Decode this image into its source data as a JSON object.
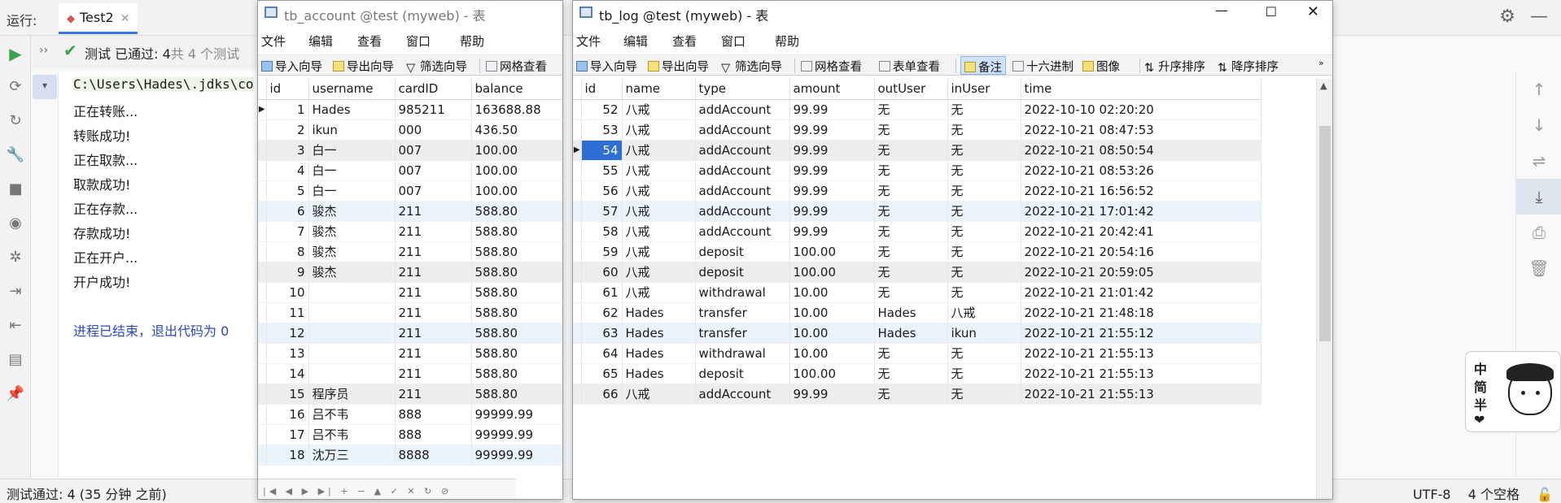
{
  "ide": {
    "run_label": "运行:",
    "tab_name": "Test2",
    "test_summary": "测试 已通过: 4",
    "test_summary_total": "共 4 个测试",
    "console_lines": [
      "正在转账...",
      "转账成功!",
      "正在取款...",
      "取款成功!",
      "正在存款...",
      "存款成功!",
      "正在开户...",
      "开户成功!"
    ],
    "console_path": "C:\\Users\\Hades\\.jdks\\co",
    "console_exit": "进程已结束，退出代码为 0",
    "status_left": "测试通过: 4 (35 分钟 之前)",
    "status_encoding": "UTF-8",
    "status_indent": "4 个空格",
    "ime_keys": [
      "中",
      "简",
      "半"
    ]
  },
  "account_window": {
    "title": "tb_account @test (myweb) - 表",
    "menu": [
      "文件",
      "编辑",
      "查看",
      "窗口",
      "帮助"
    ],
    "toolbar": [
      "导入向导",
      "导出向导",
      "筛选向导",
      "网格查看"
    ],
    "columns": [
      "id",
      "username",
      "cardID",
      "balance"
    ],
    "rows": [
      [
        "1",
        "Hades",
        "985211",
        "163688.88"
      ],
      [
        "2",
        "ikun",
        "000",
        "436.50"
      ],
      [
        "3",
        "白一",
        "007",
        "100.00"
      ],
      [
        "4",
        "白一",
        "007",
        "100.00"
      ],
      [
        "5",
        "白一",
        "007",
        "100.00"
      ],
      [
        "6",
        "骏杰",
        "211",
        "588.80"
      ],
      [
        "7",
        "骏杰",
        "211",
        "588.80"
      ],
      [
        "8",
        "骏杰",
        "211",
        "588.80"
      ],
      [
        "9",
        "骏杰",
        "211",
        "588.80"
      ],
      [
        "10",
        "",
        "211",
        "588.80"
      ],
      [
        "11",
        "",
        "211",
        "588.80"
      ],
      [
        "12",
        "",
        "211",
        "588.80"
      ],
      [
        "13",
        "",
        "211",
        "588.80"
      ],
      [
        "14",
        "",
        "211",
        "588.80"
      ],
      [
        "15",
        "程序员",
        "211",
        "588.80"
      ],
      [
        "16",
        "吕不韦",
        "888",
        "99999.99"
      ],
      [
        "17",
        "吕不韦",
        "888",
        "99999.99"
      ],
      [
        "18",
        "沈万三",
        "8888",
        "99999.99"
      ]
    ]
  },
  "log_window": {
    "title": "tb_log @test (myweb) - 表",
    "menu": [
      "文件",
      "编辑",
      "查看",
      "窗口",
      "帮助"
    ],
    "toolbar": [
      "导入向导",
      "导出向导",
      "筛选向导",
      "网格查看",
      "表单查看",
      "备注",
      "十六进制",
      "图像",
      "升序排序",
      "降序排序"
    ],
    "columns": [
      "id",
      "name",
      "type",
      "amount",
      "outUser",
      "inUser",
      "time"
    ],
    "selected_id": "54",
    "rows": [
      [
        "52",
        "八戒",
        "addAccount",
        "99.99",
        "无",
        "无",
        "2022-10-10 02:20:20"
      ],
      [
        "53",
        "八戒",
        "addAccount",
        "99.99",
        "无",
        "无",
        "2022-10-21 08:47:53"
      ],
      [
        "54",
        "八戒",
        "addAccount",
        "99.99",
        "无",
        "无",
        "2022-10-21 08:50:54"
      ],
      [
        "55",
        "八戒",
        "addAccount",
        "99.99",
        "无",
        "无",
        "2022-10-21 08:53:26"
      ],
      [
        "56",
        "八戒",
        "addAccount",
        "99.99",
        "无",
        "无",
        "2022-10-21 16:56:52"
      ],
      [
        "57",
        "八戒",
        "addAccount",
        "99.99",
        "无",
        "无",
        "2022-10-21 17:01:42"
      ],
      [
        "58",
        "八戒",
        "addAccount",
        "99.99",
        "无",
        "无",
        "2022-10-21 20:42:41"
      ],
      [
        "59",
        "八戒",
        "deposit",
        "100.00",
        "无",
        "无",
        "2022-10-21 20:54:16"
      ],
      [
        "60",
        "八戒",
        "deposit",
        "100.00",
        "无",
        "无",
        "2022-10-21 20:59:05"
      ],
      [
        "61",
        "八戒",
        "withdrawal",
        "10.00",
        "无",
        "无",
        "2022-10-21 21:01:42"
      ],
      [
        "62",
        "Hades",
        "transfer",
        "10.00",
        "Hades",
        "八戒",
        "2022-10-21 21:48:18"
      ],
      [
        "63",
        "Hades",
        "transfer",
        "10.00",
        "Hades",
        "ikun",
        "2022-10-21 21:55:12"
      ],
      [
        "64",
        "Hades",
        "withdrawal",
        "10.00",
        "无",
        "无",
        "2022-10-21 21:55:13"
      ],
      [
        "65",
        "Hades",
        "deposit",
        "100.00",
        "无",
        "无",
        "2022-10-21 21:55:13"
      ],
      [
        "66",
        "八戒",
        "addAccount",
        "99.99",
        "无",
        "无",
        "2022-10-21 21:55:13"
      ]
    ]
  }
}
